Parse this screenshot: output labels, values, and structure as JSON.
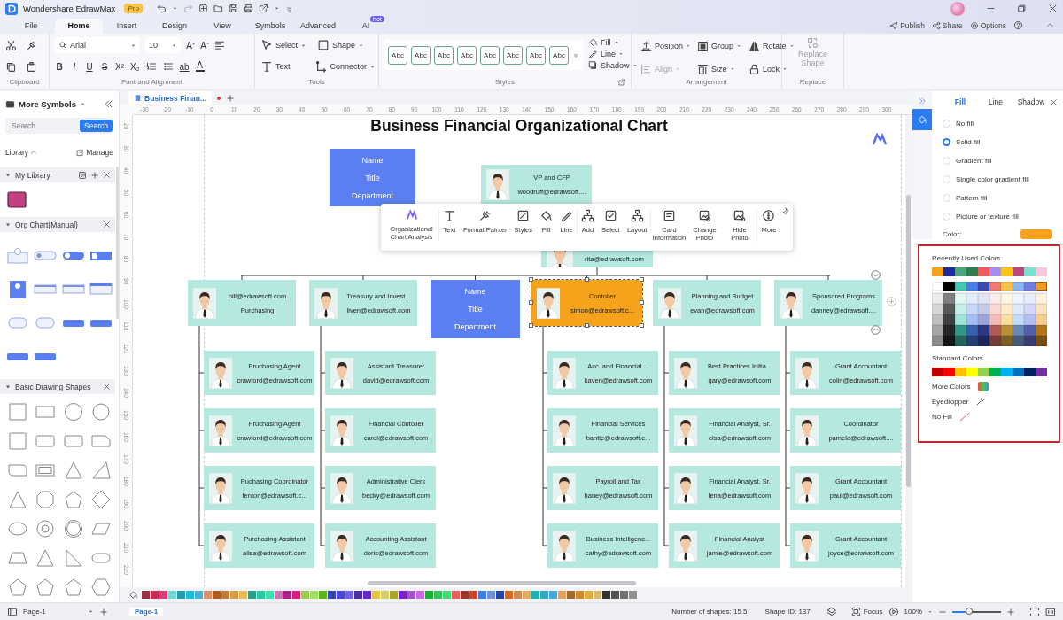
{
  "title_bar": {
    "app_name": "Wondershare EdrawMax",
    "badge": "Pro"
  },
  "menu_tabs": [
    {
      "label": "File",
      "selected": false
    },
    {
      "label": "Home",
      "selected": true
    },
    {
      "label": "Insert",
      "selected": false
    },
    {
      "label": "Design",
      "selected": false
    },
    {
      "label": "View",
      "selected": false
    },
    {
      "label": "Symbols",
      "selected": false
    },
    {
      "label": "Advanced",
      "selected": false
    },
    {
      "label": "AI",
      "selected": false,
      "badge": "hot"
    }
  ],
  "top_actions": [
    {
      "label": "Publish"
    },
    {
      "label": "Share"
    },
    {
      "label": "Options"
    }
  ],
  "ribbon": {
    "clipboard": {
      "label": "Clipboard"
    },
    "font": {
      "label": "Font and Alignment",
      "font_name": "Arial",
      "font_size": "10",
      "size_buttons": [
        "A⁺",
        "A⁻"
      ],
      "format_buttons": [
        "B",
        "I",
        "U",
        "S",
        "X²",
        "X₂"
      ],
      "highlight": "ab",
      "font_color": "A"
    },
    "tools": {
      "label": "Tools",
      "items": [
        {
          "label": "Select"
        },
        {
          "label": "Shape"
        },
        {
          "label": "Text"
        },
        {
          "label": "Connector"
        }
      ]
    },
    "styles": {
      "label": "Styles",
      "swatches": [
        "Abc",
        "Abc",
        "Abc",
        "Abc",
        "Abc",
        "Abc",
        "Abc",
        "Abc"
      ]
    },
    "fill_line": [
      {
        "label": "Fill"
      },
      {
        "label": "Line"
      },
      {
        "label": "Shadow"
      }
    ],
    "arrangement": {
      "label": "Arrangement",
      "items": [
        {
          "label": "Position",
          "disabled": false
        },
        {
          "label": "Group",
          "disabled": false
        },
        {
          "label": "Rotate",
          "disabled": false
        },
        {
          "label": "Align",
          "disabled": true
        },
        {
          "label": "Size",
          "disabled": false
        },
        {
          "label": "Lock",
          "disabled": false
        }
      ]
    },
    "replace": {
      "label": "Replace",
      "button": "Replace Shape",
      "disabled": true
    }
  },
  "symbols_panel": {
    "title": "More Symbols",
    "search": {
      "placeholder": "Search",
      "button": "Search"
    },
    "library": "Library",
    "manage": "Manage",
    "sections": [
      {
        "title": "My Library"
      },
      {
        "title": "Org Chart(Manual)"
      },
      {
        "title": "Basic Drawing Shapes"
      }
    ]
  },
  "document_tab": {
    "title": "Business Finan...",
    "unsaved": true
  },
  "ruler": {
    "horizontal": [
      "-30",
      "-20",
      "-10",
      "0",
      "10",
      "20",
      "30",
      "40",
      "50",
      "60",
      "70",
      "80",
      "90",
      "100",
      "110",
      "120",
      "130",
      "140",
      "150",
      "160",
      "170",
      "180",
      "190",
      "200",
      "210",
      "220",
      "230",
      "240",
      "250",
      "260",
      "270",
      "280",
      "290",
      "300"
    ],
    "vertical": [
      "20",
      "30",
      "40",
      "50",
      "60",
      "70",
      "80",
      "90",
      "100",
      "110",
      "120",
      "130",
      "140",
      "150",
      "160",
      "170",
      "180",
      "190",
      "200",
      "210",
      "220"
    ]
  },
  "chart": {
    "title": "Business Financial Organizational Chart",
    "top": [
      {
        "kind": "placeholder",
        "selected": false,
        "lines": [
          "Name",
          "Title",
          "Department"
        ]
      },
      {
        "kind": "person",
        "selected": false,
        "lines": [
          "VP and CFP",
          "woodruff@edrawsoft...."
        ]
      },
      {
        "kind": "person",
        "selected": false,
        "lines": [
          "rita@edrawsoft.com"
        ]
      }
    ],
    "departments": [
      {
        "kind": "person",
        "selected": false,
        "lines": [
          "bill@edrawsoft.com",
          "Purchasing"
        ],
        "children": [
          {
            "kind": "person",
            "selected": false,
            "lines": [
              "Pruchasing Agent",
              "crawford@edrawsoft.com"
            ]
          },
          {
            "kind": "person",
            "selected": false,
            "lines": [
              "Pruchasing Agent",
              "crawford@edrawsoft.com"
            ]
          },
          {
            "kind": "person",
            "selected": false,
            "lines": [
              "Puchasing Coordinator",
              "fenton@edrawsoft.c..."
            ]
          },
          {
            "kind": "person",
            "selected": false,
            "lines": [
              "Purchasing Assistant",
              "ailsa@edrawsoft.com"
            ]
          }
        ]
      },
      {
        "kind": "person",
        "selected": false,
        "lines": [
          "Treasury and Invest...",
          "liven@edrawsoft.com"
        ],
        "children": [
          {
            "kind": "person",
            "selected": false,
            "lines": [
              "Assistant Treasurer",
              "david@edrawsoft.com"
            ]
          },
          {
            "kind": "person",
            "selected": false,
            "lines": [
              "Financial Contoller",
              "carol@edrawsoft.com"
            ]
          },
          {
            "kind": "person",
            "selected": false,
            "lines": [
              "Administrative Clerk",
              "becky@edrawsoft.com"
            ]
          },
          {
            "kind": "person",
            "selected": false,
            "lines": [
              "Accounting Assistant",
              "doris@edrawsoft.com"
            ]
          }
        ]
      },
      {
        "kind": "placeholder",
        "selected": false,
        "lines": [
          "Name",
          "Title",
          "Department"
        ]
      },
      {
        "kind": "person",
        "selected": true,
        "lines": [
          "Contoller",
          "simon@edrawsoft.c..."
        ],
        "children": [
          {
            "kind": "person",
            "selected": false,
            "lines": [
              "Acc. and Financial ...",
              "kaven@edrawsoft.com"
            ]
          },
          {
            "kind": "person",
            "selected": false,
            "lines": [
              "Financial Services",
              "bantle@edrawsoft.c..."
            ]
          },
          {
            "kind": "person",
            "selected": false,
            "lines": [
              "Payroll and Tax",
              "haney@edrawsoft.com"
            ]
          },
          {
            "kind": "person",
            "selected": false,
            "lines": [
              "Business Intelligenc...",
              "cathy@edrawsoft.com"
            ]
          }
        ]
      },
      {
        "kind": "person",
        "selected": false,
        "lines": [
          "Planning and Budget",
          "evan@edrawsoft.com"
        ],
        "children": [
          {
            "kind": "person",
            "selected": false,
            "lines": [
              "Best Practices Initia...",
              "gary@edrawsoft.com"
            ]
          },
          {
            "kind": "person",
            "selected": false,
            "lines": [
              "Financial Analyst, Sr.",
              "elsa@edrawsoft.com"
            ]
          },
          {
            "kind": "person",
            "selected": false,
            "lines": [
              "Financial Analyst, Sr.",
              "lena@edrawsoft.com"
            ]
          },
          {
            "kind": "person",
            "selected": false,
            "lines": [
              "Financial Analyst",
              "jamie@edrawsoft.com"
            ]
          }
        ]
      },
      {
        "kind": "person",
        "selected": false,
        "lines": [
          "Sponsored Programs",
          "danney@edrawsoft...."
        ],
        "children": [
          {
            "kind": "person",
            "selected": false,
            "lines": [
              "Grant Accountant",
              "colin@edrawsoft.com"
            ]
          },
          {
            "kind": "person",
            "selected": false,
            "lines": [
              "Coordinator",
              "pamela@edrawsoft...."
            ]
          },
          {
            "kind": "person",
            "selected": false,
            "lines": [
              "Grant Accountant",
              "paul@edrawsoft.com"
            ]
          },
          {
            "kind": "person",
            "selected": false,
            "lines": [
              "Grant Accountant",
              "joyce@edrawsoft.com"
            ]
          }
        ]
      }
    ]
  },
  "floating_toolbar": [
    {
      "label": "Organizational Chart Analysis"
    },
    {
      "label": "Text"
    },
    {
      "label": "Format Painter"
    },
    {
      "label": "Styles"
    },
    {
      "label": "Fill"
    },
    {
      "label": "Line"
    },
    {
      "label": "Add"
    },
    {
      "label": "Select"
    },
    {
      "label": "Layout"
    },
    {
      "label": "Card Information"
    },
    {
      "label": "Change Photo"
    },
    {
      "label": "Hide Photo"
    },
    {
      "label": "More"
    }
  ],
  "format_panel": {
    "tabs": [
      {
        "label": "Fill",
        "selected": true
      },
      {
        "label": "Line",
        "selected": false
      },
      {
        "label": "Shadow",
        "selected": false
      }
    ],
    "fill_options": [
      {
        "label": "No fill",
        "selected": false
      },
      {
        "label": "Solid fill",
        "selected": true
      },
      {
        "label": "Gradient fill",
        "selected": false
      },
      {
        "label": "Single color gradient fill",
        "selected": false
      },
      {
        "label": "Pattern fill",
        "selected": false
      },
      {
        "label": "Picture or texture fill",
        "selected": false
      }
    ],
    "color_label": "Color:",
    "color": "#f7a21b",
    "picker": {
      "recent_title": "Recently Used Colors",
      "recent": [
        {
          "color": "#f7a21b"
        },
        {
          "color": "#1f2aa0"
        },
        {
          "color": "#4aa57a"
        },
        {
          "color": "#2e7d4a"
        },
        {
          "color": "#ef5b5b"
        },
        {
          "color": "#a48ff0"
        },
        {
          "color": "#f7c31a"
        },
        {
          "color": "#c0457e"
        },
        {
          "color": "#7fded0"
        },
        {
          "color": "#f5c6dc"
        }
      ],
      "theme": [
        {
          "color": "#ffffff",
          "selected": false
        },
        {
          "color": "#000000",
          "selected": false
        },
        {
          "color": "#45c7b5",
          "selected": false
        },
        {
          "color": "#4a7ee8",
          "selected": false
        },
        {
          "color": "#3a4bb0",
          "selected": false
        },
        {
          "color": "#f07870",
          "selected": false
        },
        {
          "color": "#f7c04a",
          "selected": false
        },
        {
          "color": "#8ab5f0",
          "selected": false
        },
        {
          "color": "#6f7ee0",
          "selected": false
        },
        {
          "color": "#f09a20",
          "selected": true
        }
      ],
      "standard_title": "Standard Colors",
      "standard": [
        {
          "color": "#c00000"
        },
        {
          "color": "#ff0000"
        },
        {
          "color": "#ffc000"
        },
        {
          "color": "#ffff00"
        },
        {
          "color": "#92d050"
        },
        {
          "color": "#00b050"
        },
        {
          "color": "#00b0f0"
        },
        {
          "color": "#0070c0"
        },
        {
          "color": "#002060"
        },
        {
          "color": "#7030a0"
        }
      ],
      "more_colors": "More Colors",
      "eyedropper": "Eyedropper",
      "no_fill": "No Fill"
    }
  },
  "status_bar": {
    "page_select": "Page-1",
    "pages": [
      {
        "label": "Page-1",
        "selected": true
      }
    ],
    "shape_count": "Number of shapes: 15.5",
    "shape_id": "Shape ID: 137",
    "focus": "Focus",
    "zoom": "100%",
    "zoom_slider": {
      "level": 0.35
    }
  }
}
